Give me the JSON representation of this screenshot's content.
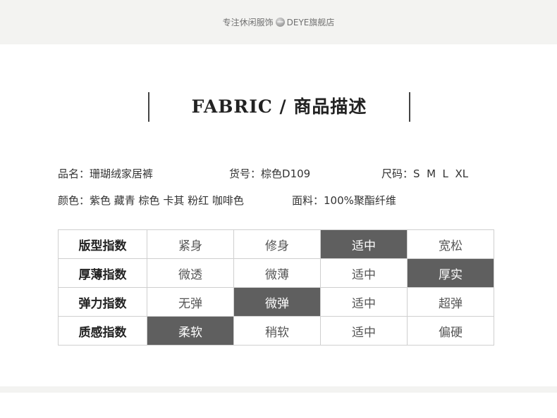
{
  "header": {
    "text_before": "专注休闲服饰",
    "brand": "DEYE旗舰店",
    "logo_icon": "globe-icon"
  },
  "title": {
    "en": "FABRIC",
    "separator": "/",
    "zh": "商品描述"
  },
  "info": {
    "name_label": "品名：",
    "name_value": "珊瑚绒家居裤",
    "sku_label": "货号：",
    "sku_value": "棕色D109",
    "size_label": "尺码：",
    "size_value": "S  M  L  XL",
    "color_label": "颜色：",
    "color_value": "紫色 藏青 棕色 卡其 粉红 咖啡色",
    "fabric_label": "面料：",
    "fabric_value": "100%聚酯纤维"
  },
  "spec_table": {
    "rows": [
      {
        "label": "版型指数",
        "options": [
          "紧身",
          "修身",
          "适中",
          "宽松"
        ],
        "selected": 2
      },
      {
        "label": "厚薄指数",
        "options": [
          "微透",
          "微薄",
          "适中",
          "厚实"
        ],
        "selected": 3
      },
      {
        "label": "弹力指数",
        "options": [
          "无弹",
          "微弹",
          "适中",
          "超弹"
        ],
        "selected": 1
      },
      {
        "label": "质感指数",
        "options": [
          "柔软",
          "稍软",
          "适中",
          "偏硬"
        ],
        "selected": 0
      }
    ],
    "highlight_color": "#5f5f5f"
  }
}
